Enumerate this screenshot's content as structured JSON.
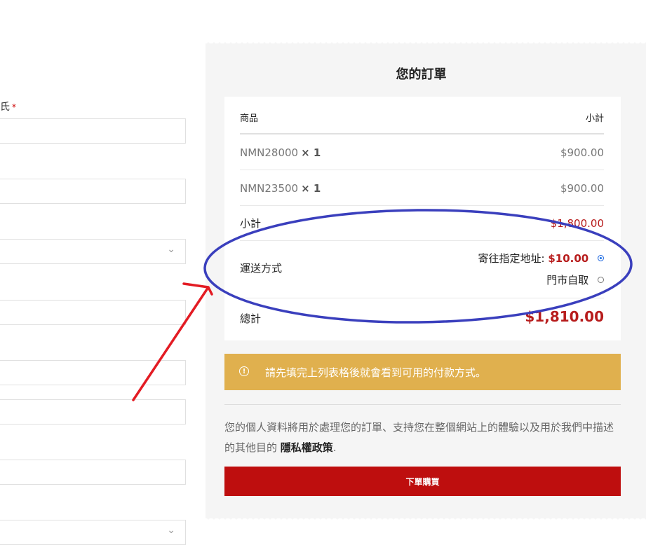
{
  "form": {
    "last_name_label": "氏",
    "required_mark": "*"
  },
  "order_review": {
    "title": "您的訂單",
    "col_product": "商品",
    "col_subtotal": "小計",
    "items": [
      {
        "name": "NMN28000",
        "qty": "× 1",
        "price": "$900.00"
      },
      {
        "name": "NMN23500",
        "qty": "× 1",
        "price": "$900.00"
      }
    ],
    "subtotal_label": "小計",
    "subtotal_value": "$1,800.00",
    "shipping_label": "運送方式",
    "shipping_options": [
      {
        "label": "寄往指定地址:",
        "price": "$10.00",
        "selected": true
      },
      {
        "label": "門市自取",
        "price": "",
        "selected": false
      }
    ],
    "total_label": "總計",
    "total_value": "$1,810.00"
  },
  "notice": {
    "icon": "info-circle-icon",
    "text": "請先填完上列表格後就會看到可用的付款方式。"
  },
  "privacy": {
    "text": "您的個人資料將用於處理您的訂單、支持您在整個網站上的體驗以及用於我們中描述的其他目的",
    "link": "隱私權政策",
    "suffix": "."
  },
  "place_order_label": "下單購買",
  "colors": {
    "accent_red": "#be0e0e",
    "notice_gold": "#e0b04e",
    "annotation_circle": "#3a3fbd",
    "annotation_arrow": "#e31b23"
  }
}
